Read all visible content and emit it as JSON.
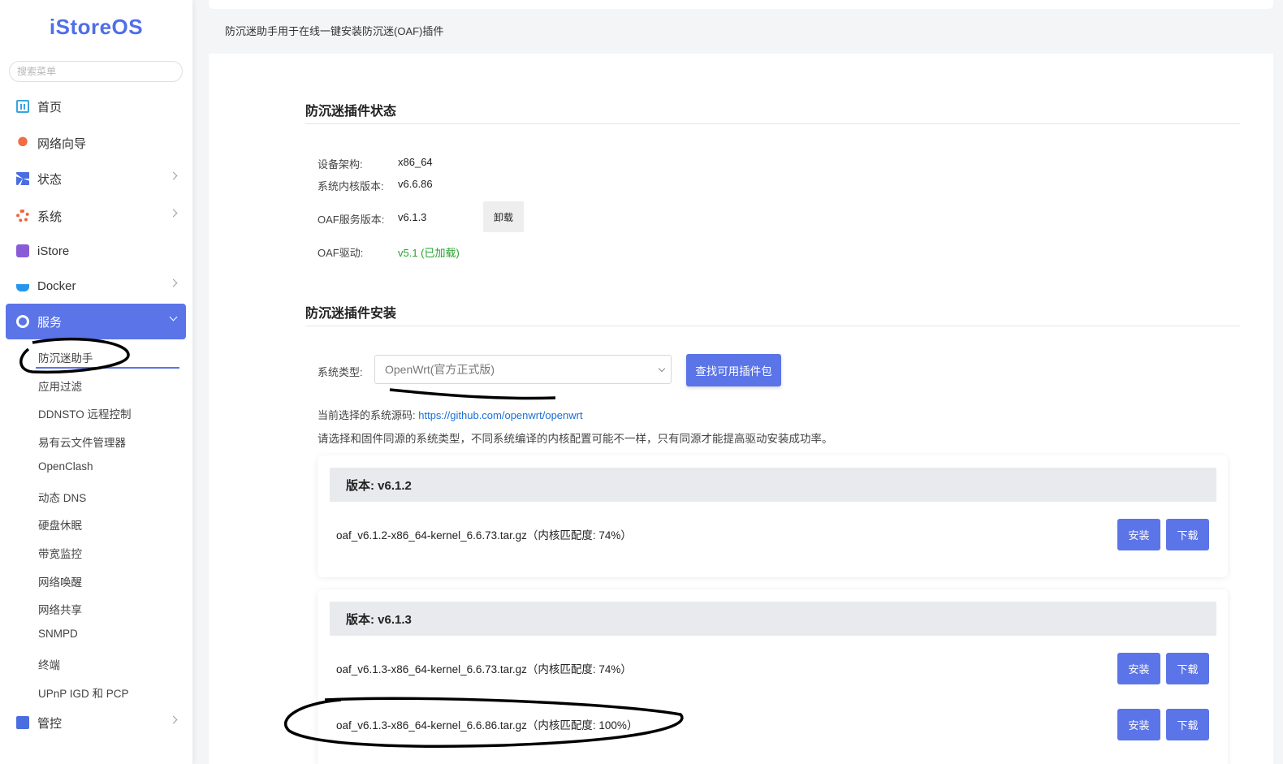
{
  "sidebar": {
    "logo": "iStoreOS",
    "search_placeholder": "搜索菜单",
    "items": [
      {
        "label": "首页",
        "icon": "home-icon"
      },
      {
        "label": "网络向导",
        "icon": "wizard-icon"
      },
      {
        "label": "状态",
        "icon": "status-icon"
      },
      {
        "label": "系统",
        "icon": "system-gear-icon"
      },
      {
        "label": "iStore",
        "icon": "istore-icon"
      },
      {
        "label": "Docker",
        "icon": "docker-icon"
      },
      {
        "label": "服务",
        "icon": "services-icon"
      },
      {
        "label": "管控",
        "icon": "control-icon"
      }
    ],
    "sub_items": [
      "防沉迷助手",
      "应用过滤",
      "DDNSTO 远程控制",
      "易有云文件管理器",
      "OpenClash",
      "动态 DNS",
      "硬盘休眠",
      "带宽监控",
      "网络唤醒",
      "网络共享",
      "SNMPD",
      "终端",
      "UPnP IGD 和 PCP"
    ]
  },
  "header": {
    "description": "防沉迷助手用于在线一键安装防沉迷(OAF)插件"
  },
  "status_section": {
    "title": "防沉迷插件状态",
    "arch_label": "设备架构:",
    "arch_value": "x86_64",
    "kernel_label": "系统内核版本:",
    "kernel_value": "v6.6.86",
    "oaf_service_label": "OAF服务版本:",
    "oaf_service_value": "v6.1.3",
    "unload_button": "卸载",
    "oaf_driver_label": "OAF驱动:",
    "oaf_driver_value": "v5.1 (已加载)",
    "driver_color": "#27a22b"
  },
  "install_section": {
    "title": "防沉迷插件安装",
    "system_type_label": "系统类型:",
    "system_type_value": "OpenWrt(官方正式版)",
    "find_button": "查找可用插件包",
    "source_prefix": "当前选择的系统源码:",
    "source_url": "https://github.com/openwrt/openwrt",
    "hint": "请选择和固件同源的系统类型，不同系统编译的内核配置可能不一样，只有同源才能提高驱动安装成功率。"
  },
  "versions": [
    {
      "title": "版本: v6.1.2",
      "files": [
        {
          "name": "oaf_v6.1.2-x86_64-kernel_6.6.73.tar.gz（内核匹配度: 74%）"
        }
      ]
    },
    {
      "title": "版本: v6.1.3",
      "files": [
        {
          "name": "oaf_v6.1.3-x86_64-kernel_6.6.73.tar.gz（内核匹配度: 74%）"
        },
        {
          "name": "oaf_v6.1.3-x86_64-kernel_6.6.86.tar.gz（内核匹配度: 100%）"
        }
      ]
    }
  ],
  "actions": {
    "install": "安装",
    "download": "下载"
  },
  "colors": {
    "accent": "#5b74e8",
    "logo": "#4f6fe8",
    "link": "#1a6fd6"
  }
}
